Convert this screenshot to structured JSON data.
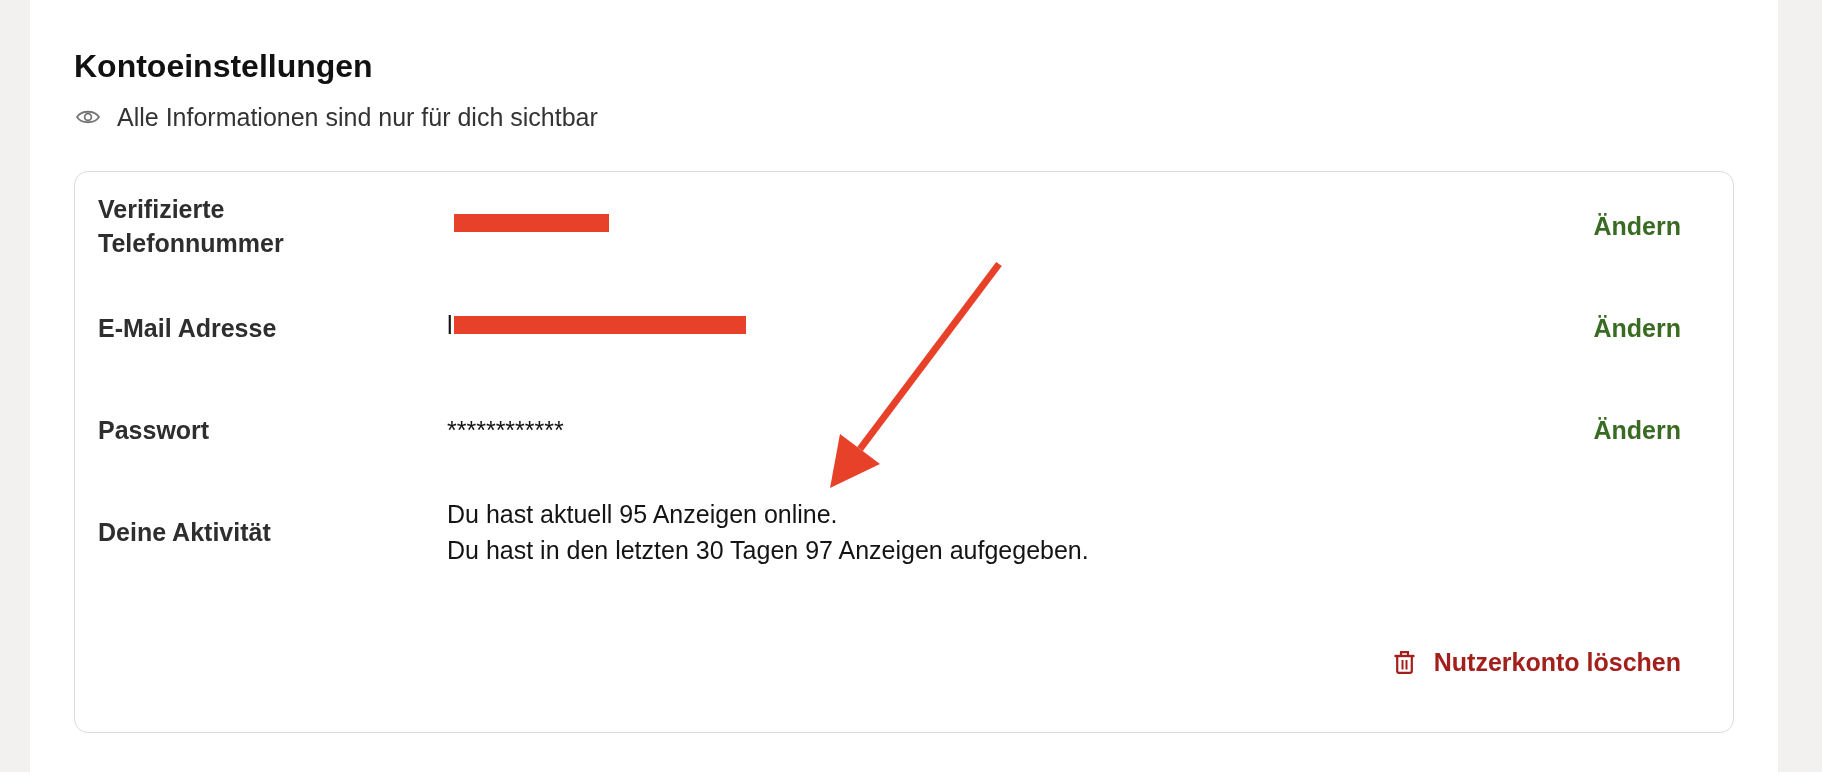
{
  "page": {
    "title": "Kontoeinstellungen",
    "privacy_note": "Alle Informationen sind nur für dich sichtbar"
  },
  "settings": [
    {
      "label": "Verifizierte Telefonnummer",
      "value": {
        "kind": "redacted"
      },
      "action": "Ändern"
    },
    {
      "label": "E-Mail Adresse",
      "value": {
        "kind": "redacted",
        "prefix": "l"
      },
      "action": "Ändern"
    },
    {
      "label": "Passwort",
      "value": {
        "kind": "text",
        "lines": [
          "************"
        ]
      },
      "action": "Ändern"
    },
    {
      "label": "Deine Aktivität",
      "value": {
        "kind": "text",
        "lines": [
          "Du hast aktuell 95 Anzeigen online.",
          "Du hast in den letzten 30 Tagen 97 Anzeigen aufgegeben."
        ]
      }
    }
  ],
  "delete_account": {
    "label": "Nutzerkonto löschen"
  },
  "annotation": {
    "kind": "arrow"
  }
}
